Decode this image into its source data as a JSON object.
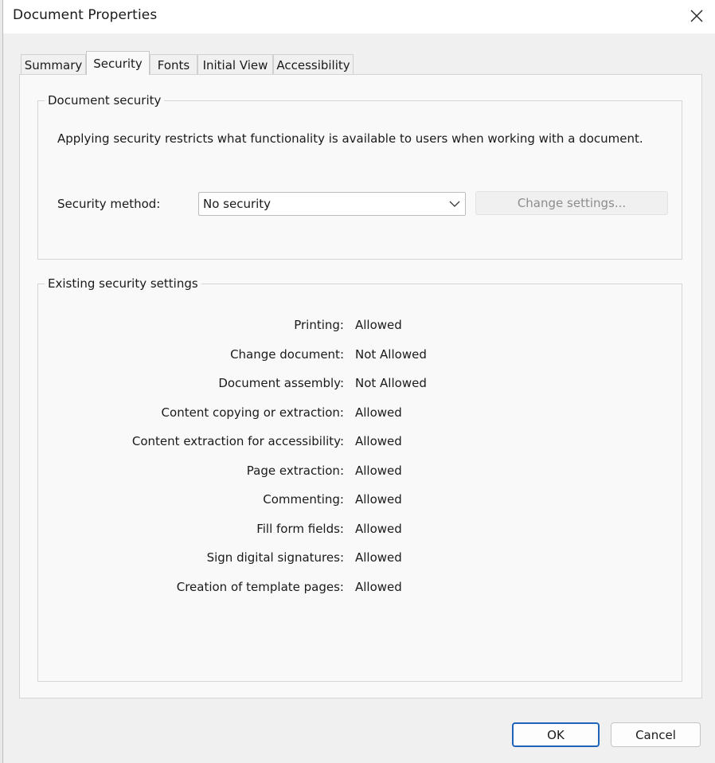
{
  "window": {
    "title": "Document Properties"
  },
  "tabs": [
    {
      "label": "Summary",
      "active": false
    },
    {
      "label": "Security",
      "active": true
    },
    {
      "label": "Fonts",
      "active": false
    },
    {
      "label": "Initial View",
      "active": false
    },
    {
      "label": "Accessibility",
      "active": false
    }
  ],
  "document_security": {
    "legend": "Document security",
    "description": "Applying security restricts what functionality is available to users when working with a document.",
    "method_label": "Security method:",
    "method_value": "No security",
    "change_settings_label": "Change settings..."
  },
  "existing_settings": {
    "legend": "Existing security settings",
    "rows": [
      {
        "label": "Printing:",
        "value": "Allowed"
      },
      {
        "label": "Change document:",
        "value": "Not Allowed"
      },
      {
        "label": "Document assembly:",
        "value": "Not Allowed"
      },
      {
        "label": "Content copying or extraction:",
        "value": "Allowed"
      },
      {
        "label": "Content extraction for accessibility:",
        "value": "Allowed"
      },
      {
        "label": "Page extraction:",
        "value": "Allowed"
      },
      {
        "label": "Commenting:",
        "value": "Allowed"
      },
      {
        "label": "Fill form fields:",
        "value": "Allowed"
      },
      {
        "label": "Sign digital signatures:",
        "value": "Allowed"
      },
      {
        "label": "Creation of template pages:",
        "value": "Allowed"
      }
    ]
  },
  "footer": {
    "ok_label": "OK",
    "cancel_label": "Cancel"
  },
  "icons": {
    "close": "close-icon",
    "dropdown": "chevron-down-icon"
  },
  "colors": {
    "primary_button_border": "#1f64b8",
    "dialog_background": "#f0f0f0",
    "panel_background": "#f9f9f9",
    "disabled_text": "#8d8d8d"
  }
}
